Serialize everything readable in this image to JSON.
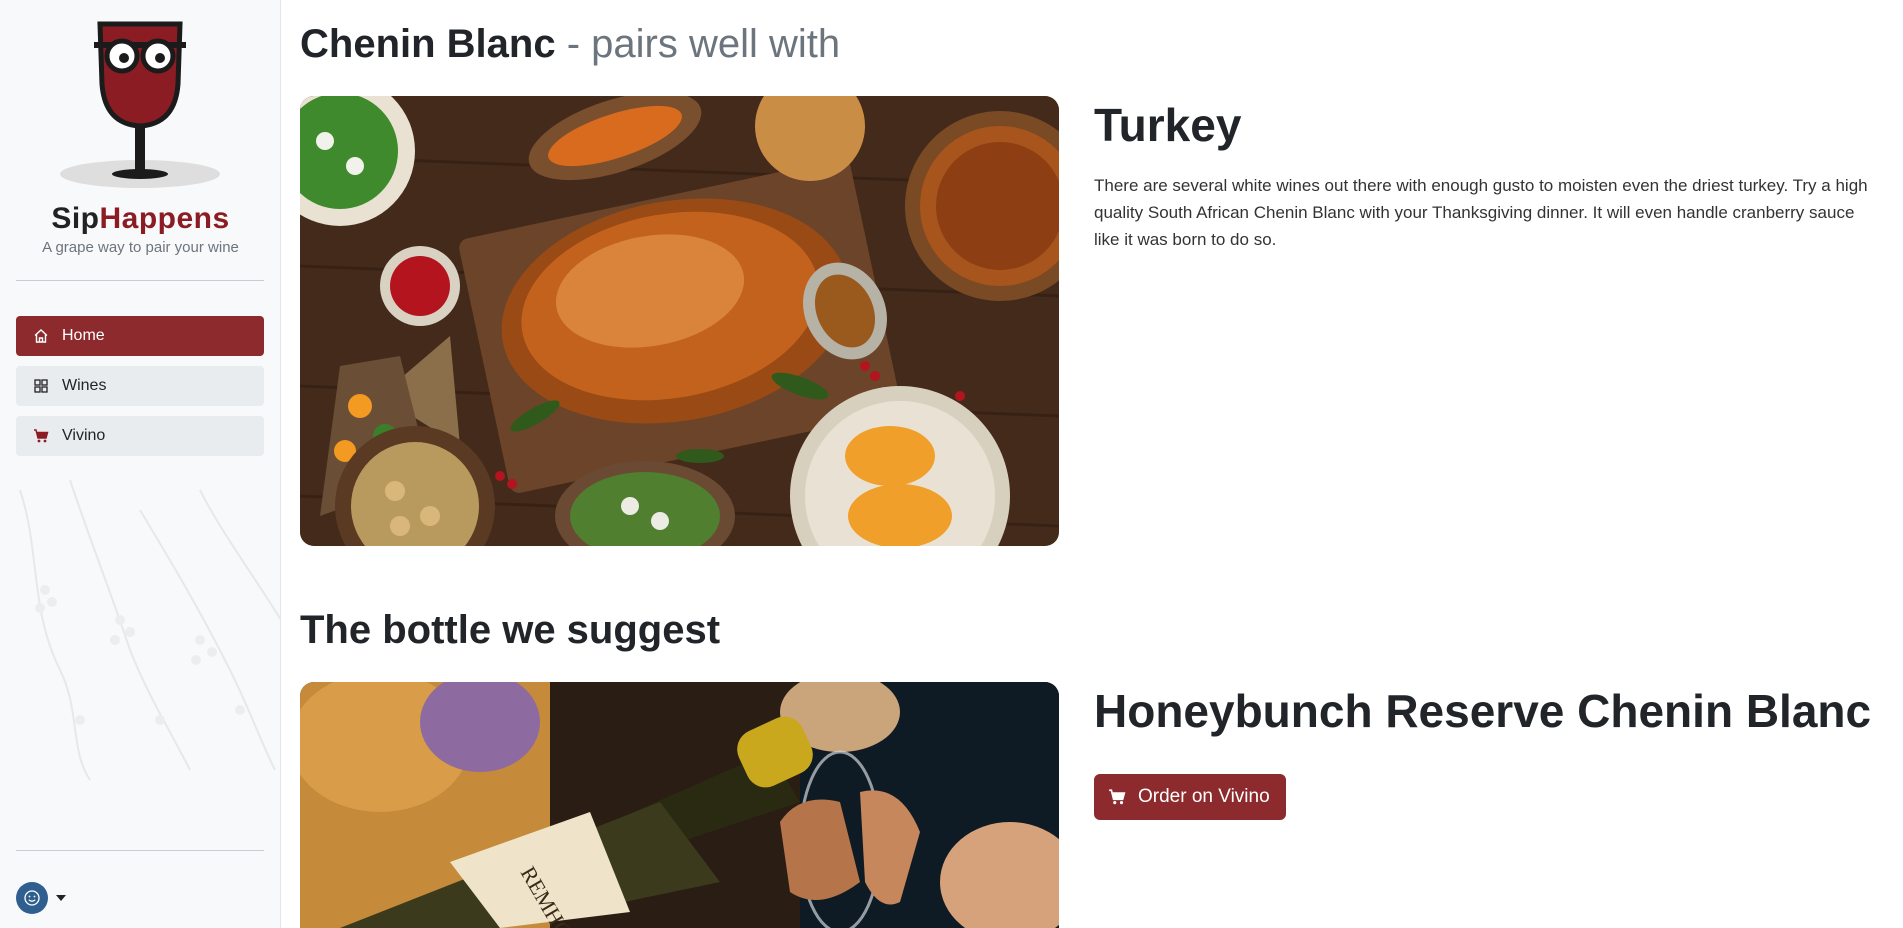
{
  "sidebar": {
    "brand_part1": "Sip",
    "brand_part2": "Happens",
    "tagline": "A grape way to pair your wine",
    "nav": [
      {
        "label": "Home",
        "icon": "home-icon",
        "active": true
      },
      {
        "label": "Wines",
        "icon": "grid-icon",
        "active": false
      },
      {
        "label": "Vivino",
        "icon": "cart-icon",
        "active": false
      }
    ],
    "user_icon": "smiley-icon"
  },
  "main": {
    "wine_name": "Chenin Blanc",
    "title_suffix": " - pairs well with",
    "food": {
      "name": "Turkey",
      "description": "There are several white wines out there with enough gusto to moisten even the driest turkey. Try a high quality South African Chenin Blanc with your Thanksgiving dinner. It will even handle cranberry sauce like it was born to do so."
    },
    "suggest_heading": "The bottle we suggest",
    "bottle": {
      "name": "Honeybunch Reserve Chenin Blanc",
      "order_label": "Order on Vivino"
    }
  },
  "colors": {
    "accent": "#8c2a2e",
    "brand_red": "#8c1c24",
    "sidebar_bg": "#f8f9fa"
  }
}
